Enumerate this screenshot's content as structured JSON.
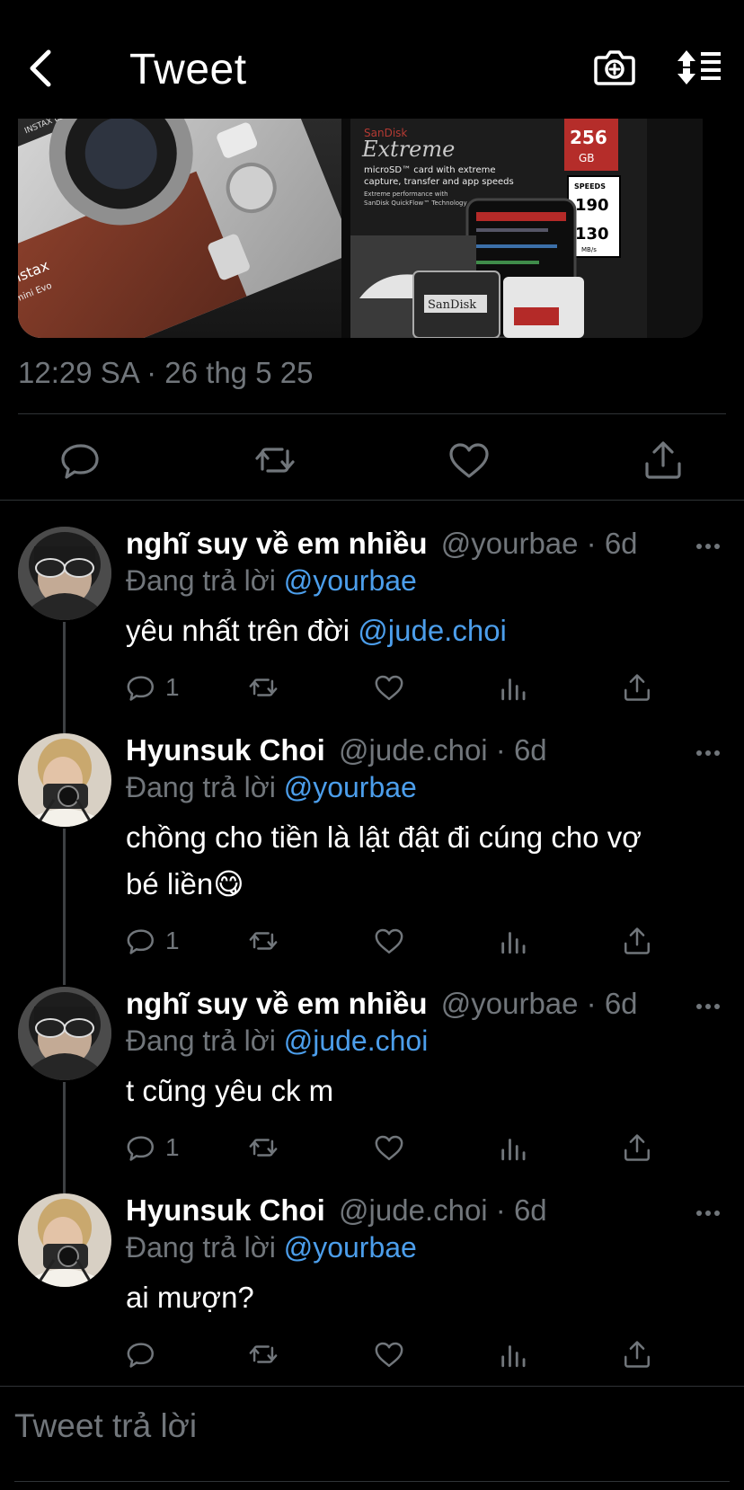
{
  "header": {
    "title": "Tweet",
    "back_icon": "chevron-left-icon",
    "camera_icon": "camera-add-icon",
    "sort_icon": "sort-replies-icon"
  },
  "tweet": {
    "image_text": {
      "instax_brand": "instax",
      "instax_model": "mini Evo",
      "instax_lens": "INSTAX LENS",
      "sd_brand": "SanDisk",
      "sd_line": "Extreme",
      "sd_desc_1": "microSD™ card with extreme",
      "sd_desc_2": "capture, transfer and app speeds",
      "sd_desc_3": "Extreme performance with",
      "sd_desc_4": "SanDisk QuickFlow™ Technology",
      "sd_capacity": "256",
      "sd_unit": "GB",
      "sd_speeds": "SPEEDS",
      "sd_read": "190",
      "sd_write": "130",
      "sd_mbs": "MB/s",
      "sd_card_label": "SanDisk"
    },
    "timestamp": "12:29 SA · 26 thg 5 25"
  },
  "replies": [
    {
      "name": "nghĩ suy về em nhiều",
      "handle": "@yourbae · 6d",
      "replying_prefix": "Đang trả lời",
      "replying_to": "@yourbae",
      "text": "yêu nhất trên đời ",
      "text_mention": "@jude.choi",
      "reply_count": "1"
    },
    {
      "name": "Hyunsuk Choi",
      "handle": "@jude.choi · 6d",
      "replying_prefix": "Đang trả lời",
      "replying_to": "@yourbae",
      "text_line1": "chồng cho tiền là lật đật đi cúng cho vợ",
      "text_line2": "bé liền😋",
      "reply_count": "1"
    },
    {
      "name": "nghĩ suy về em nhiều",
      "handle": "@yourbae · 6d",
      "replying_prefix": "Đang trả lời",
      "replying_to": "@jude.choi",
      "text": "t cũng yêu ck m",
      "reply_count": "1"
    },
    {
      "name": "Hyunsuk Choi",
      "handle": "@jude.choi · 6d",
      "replying_prefix": "Đang trả lời",
      "replying_to": "@yourbae",
      "text": "ai mượn?",
      "reply_count": ""
    }
  ],
  "composer": {
    "placeholder": "Tweet trả lời"
  },
  "colors": {
    "background": "#000000",
    "text": "#ffffff",
    "secondary": "#71767b",
    "link": "#4c9eeb",
    "divider": "#2f3336"
  }
}
